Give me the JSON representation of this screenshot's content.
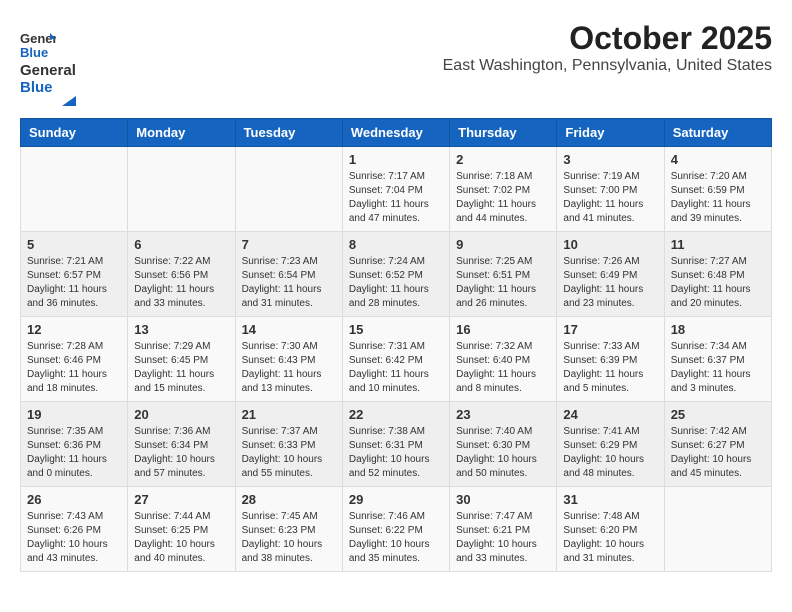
{
  "header": {
    "logo_line1": "General",
    "logo_line2": "Blue",
    "title": "October 2025",
    "subtitle": "East Washington, Pennsylvania, United States"
  },
  "days_of_week": [
    "Sunday",
    "Monday",
    "Tuesday",
    "Wednesday",
    "Thursday",
    "Friday",
    "Saturday"
  ],
  "weeks": [
    [
      {
        "day": "",
        "info": ""
      },
      {
        "day": "",
        "info": ""
      },
      {
        "day": "",
        "info": ""
      },
      {
        "day": "1",
        "info": "Sunrise: 7:17 AM\nSunset: 7:04 PM\nDaylight: 11 hours and 47 minutes."
      },
      {
        "day": "2",
        "info": "Sunrise: 7:18 AM\nSunset: 7:02 PM\nDaylight: 11 hours and 44 minutes."
      },
      {
        "day": "3",
        "info": "Sunrise: 7:19 AM\nSunset: 7:00 PM\nDaylight: 11 hours and 41 minutes."
      },
      {
        "day": "4",
        "info": "Sunrise: 7:20 AM\nSunset: 6:59 PM\nDaylight: 11 hours and 39 minutes."
      }
    ],
    [
      {
        "day": "5",
        "info": "Sunrise: 7:21 AM\nSunset: 6:57 PM\nDaylight: 11 hours and 36 minutes."
      },
      {
        "day": "6",
        "info": "Sunrise: 7:22 AM\nSunset: 6:56 PM\nDaylight: 11 hours and 33 minutes."
      },
      {
        "day": "7",
        "info": "Sunrise: 7:23 AM\nSunset: 6:54 PM\nDaylight: 11 hours and 31 minutes."
      },
      {
        "day": "8",
        "info": "Sunrise: 7:24 AM\nSunset: 6:52 PM\nDaylight: 11 hours and 28 minutes."
      },
      {
        "day": "9",
        "info": "Sunrise: 7:25 AM\nSunset: 6:51 PM\nDaylight: 11 hours and 26 minutes."
      },
      {
        "day": "10",
        "info": "Sunrise: 7:26 AM\nSunset: 6:49 PM\nDaylight: 11 hours and 23 minutes."
      },
      {
        "day": "11",
        "info": "Sunrise: 7:27 AM\nSunset: 6:48 PM\nDaylight: 11 hours and 20 minutes."
      }
    ],
    [
      {
        "day": "12",
        "info": "Sunrise: 7:28 AM\nSunset: 6:46 PM\nDaylight: 11 hours and 18 minutes."
      },
      {
        "day": "13",
        "info": "Sunrise: 7:29 AM\nSunset: 6:45 PM\nDaylight: 11 hours and 15 minutes."
      },
      {
        "day": "14",
        "info": "Sunrise: 7:30 AM\nSunset: 6:43 PM\nDaylight: 11 hours and 13 minutes."
      },
      {
        "day": "15",
        "info": "Sunrise: 7:31 AM\nSunset: 6:42 PM\nDaylight: 11 hours and 10 minutes."
      },
      {
        "day": "16",
        "info": "Sunrise: 7:32 AM\nSunset: 6:40 PM\nDaylight: 11 hours and 8 minutes."
      },
      {
        "day": "17",
        "info": "Sunrise: 7:33 AM\nSunset: 6:39 PM\nDaylight: 11 hours and 5 minutes."
      },
      {
        "day": "18",
        "info": "Sunrise: 7:34 AM\nSunset: 6:37 PM\nDaylight: 11 hours and 3 minutes."
      }
    ],
    [
      {
        "day": "19",
        "info": "Sunrise: 7:35 AM\nSunset: 6:36 PM\nDaylight: 11 hours and 0 minutes."
      },
      {
        "day": "20",
        "info": "Sunrise: 7:36 AM\nSunset: 6:34 PM\nDaylight: 10 hours and 57 minutes."
      },
      {
        "day": "21",
        "info": "Sunrise: 7:37 AM\nSunset: 6:33 PM\nDaylight: 10 hours and 55 minutes."
      },
      {
        "day": "22",
        "info": "Sunrise: 7:38 AM\nSunset: 6:31 PM\nDaylight: 10 hours and 52 minutes."
      },
      {
        "day": "23",
        "info": "Sunrise: 7:40 AM\nSunset: 6:30 PM\nDaylight: 10 hours and 50 minutes."
      },
      {
        "day": "24",
        "info": "Sunrise: 7:41 AM\nSunset: 6:29 PM\nDaylight: 10 hours and 48 minutes."
      },
      {
        "day": "25",
        "info": "Sunrise: 7:42 AM\nSunset: 6:27 PM\nDaylight: 10 hours and 45 minutes."
      }
    ],
    [
      {
        "day": "26",
        "info": "Sunrise: 7:43 AM\nSunset: 6:26 PM\nDaylight: 10 hours and 43 minutes."
      },
      {
        "day": "27",
        "info": "Sunrise: 7:44 AM\nSunset: 6:25 PM\nDaylight: 10 hours and 40 minutes."
      },
      {
        "day": "28",
        "info": "Sunrise: 7:45 AM\nSunset: 6:23 PM\nDaylight: 10 hours and 38 minutes."
      },
      {
        "day": "29",
        "info": "Sunrise: 7:46 AM\nSunset: 6:22 PM\nDaylight: 10 hours and 35 minutes."
      },
      {
        "day": "30",
        "info": "Sunrise: 7:47 AM\nSunset: 6:21 PM\nDaylight: 10 hours and 33 minutes."
      },
      {
        "day": "31",
        "info": "Sunrise: 7:48 AM\nSunset: 6:20 PM\nDaylight: 10 hours and 31 minutes."
      },
      {
        "day": "",
        "info": ""
      }
    ]
  ]
}
